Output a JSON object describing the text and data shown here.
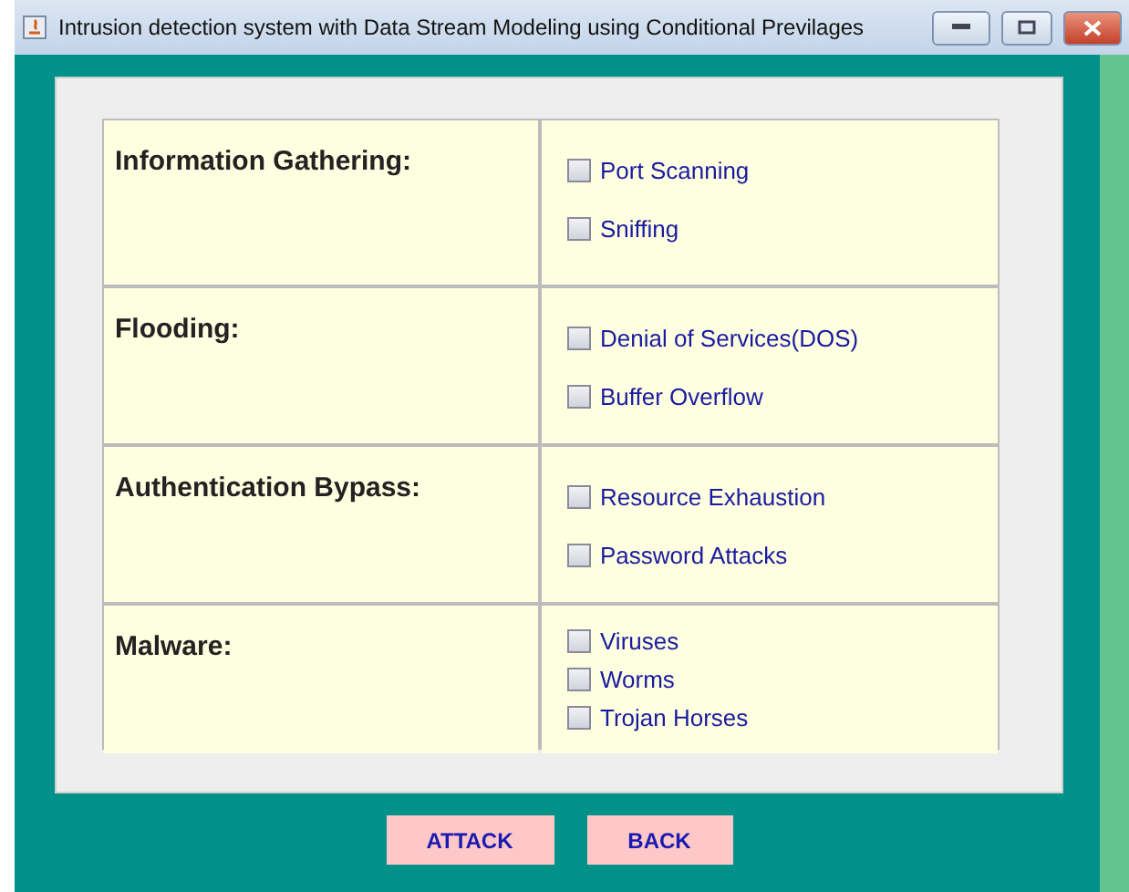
{
  "window": {
    "title": "Intrusion detection system with Data Stream Modeling using Conditional Previlages"
  },
  "categories": [
    {
      "label": "Information Gathering:",
      "options": [
        {
          "label": "Port Scanning",
          "checked": false
        },
        {
          "label": "Sniffing",
          "checked": false
        }
      ]
    },
    {
      "label": "Flooding:",
      "options": [
        {
          "label": "Denial of Services(DOS)",
          "checked": false
        },
        {
          "label": "Buffer Overflow",
          "checked": false
        }
      ]
    },
    {
      "label": "Authentication Bypass:",
      "options": [
        {
          "label": "Resource Exhaustion",
          "checked": false
        },
        {
          "label": "Password Attacks",
          "checked": false
        }
      ]
    },
    {
      "label": "Malware:",
      "options": [
        {
          "label": "Viruses",
          "checked": false
        },
        {
          "label": "Worms",
          "checked": false
        },
        {
          "label": "Trojan Horses",
          "checked": false
        }
      ]
    }
  ],
  "buttons": [
    {
      "label": "ATTACK"
    },
    {
      "label": "BACK"
    }
  ]
}
